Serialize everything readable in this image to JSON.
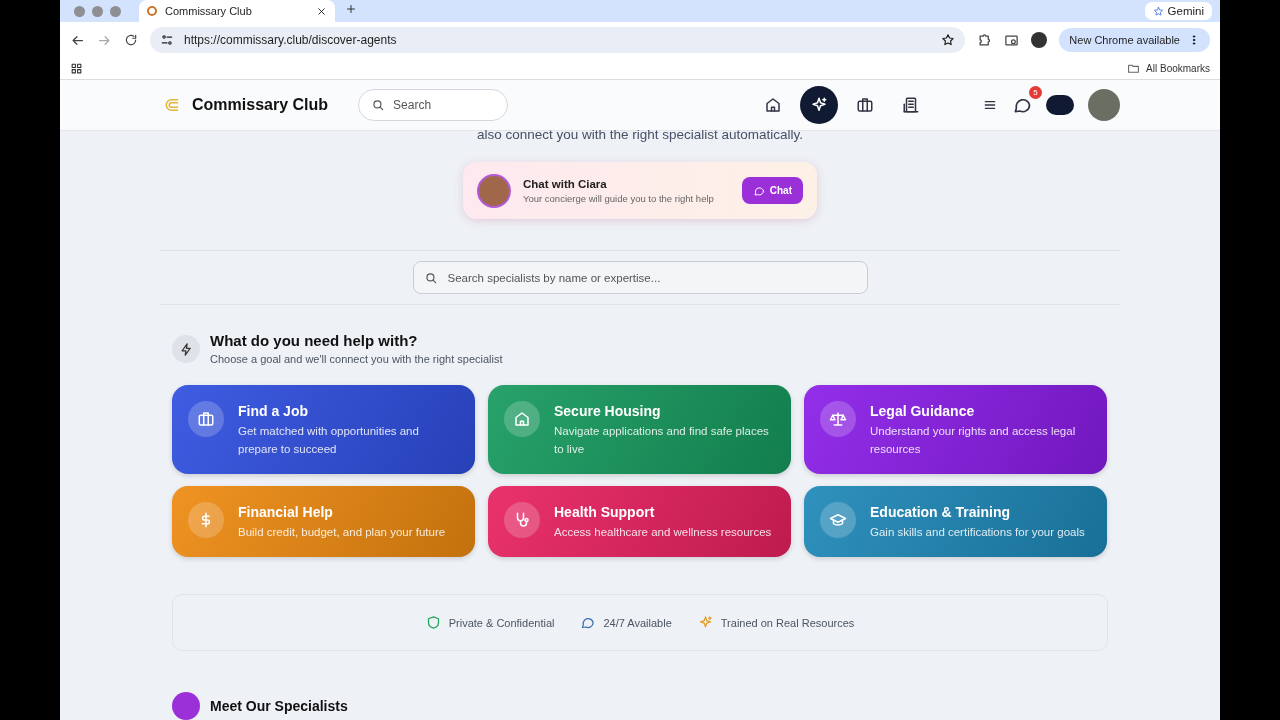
{
  "browser": {
    "tab_title": "Commissary Club",
    "url": "https://commissary.club/discover-agents",
    "gemini": "Gemini",
    "update_button": "New Chrome available",
    "bookmarks": "All Bookmarks"
  },
  "header": {
    "brand": "Commissary Club",
    "search": {
      "placeholder": "Search"
    },
    "nav": [
      {
        "selected": false
      },
      {
        "selected": true
      },
      {
        "selected": false
      },
      {
        "selected": false
      }
    ],
    "chat_badge": "5"
  },
  "hero": {
    "text": "also connect you with the right specialist automatically.",
    "concierge": {
      "title": "Chat with Ciara",
      "subtitle": "Your concierge will guide you to the right help",
      "button": "Chat"
    }
  },
  "specialist_search": {
    "placeholder": "Search specialists by name or expertise..."
  },
  "goals": {
    "title": "What do you need help with?",
    "subtitle": "Choose a goal and we'll connect you with the right specialist",
    "cards": [
      {
        "title": "Find a Job",
        "text": "Get matched with opportunities and prepare to succeed",
        "color": "#2f4fe0"
      },
      {
        "title": "Secure Housing",
        "text": "Navigate applications and find safe places to live",
        "color": "#169a5e"
      },
      {
        "title": "Legal Guidance",
        "text": "Understand your rights and access legal resources",
        "color": "#8a1de8"
      },
      {
        "title": "Financial Help",
        "text": "Build credit, budget, and plan your future",
        "color": "#ee8a10"
      },
      {
        "title": "Health Support",
        "text": "Access healthcare and wellness resources",
        "color": "#e8215f"
      },
      {
        "title": "Education & Training",
        "text": "Gain skills and certifications for your goals",
        "color": "#1e88b8"
      }
    ]
  },
  "trust": [
    "Private & Confidential",
    "24/7 Available",
    "Trained on Real Resources"
  ],
  "next_section": {
    "title": "Meet Our Specialists"
  }
}
